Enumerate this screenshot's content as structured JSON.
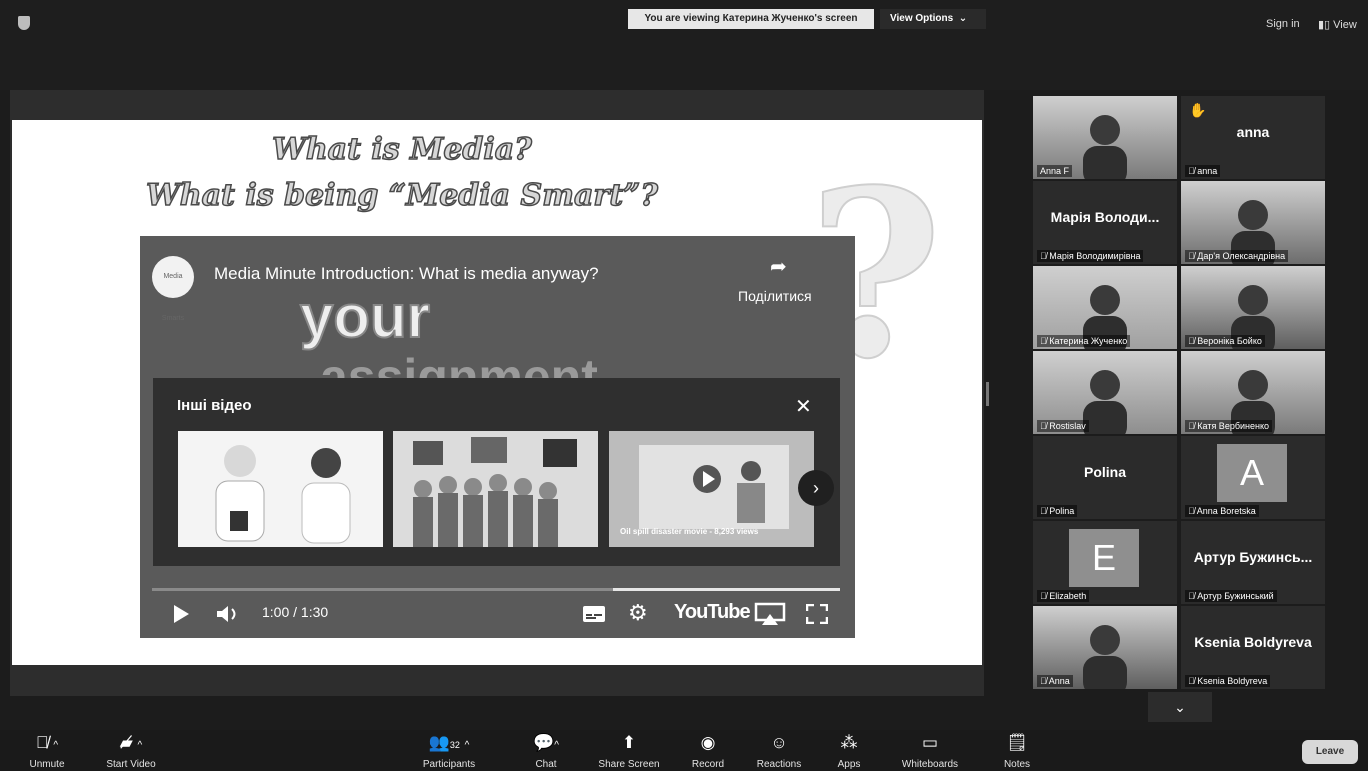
{
  "topbar": {
    "viewing_text": "You are viewing Катерина Жученко's screen",
    "view_options": "View Options",
    "view_options_caret": "⌄",
    "sign_in": "Sign in",
    "view": "View"
  },
  "slide": {
    "title_line1": "What is Media?",
    "title_line2": "What is being “Media Smart”?",
    "question_mark": "?"
  },
  "video": {
    "channel_logo_text": "Media Smarts",
    "title": "Media Minute Introduction: What is media anyway?",
    "share_label": "Поділитися",
    "overlay_word1": "your",
    "overlay_word2": "assignment",
    "more_videos_title": "Інші відео",
    "thumb3_caption": "Oil spill disaster movie - 8,293 views",
    "time": "1:00 / 1:30",
    "progress_fraction": 0.67,
    "youtube_logo": "YouTube"
  },
  "participants": [
    {
      "name": "Anna F",
      "display": "",
      "type": "video"
    },
    {
      "name": "anna",
      "display": "anna",
      "type": "name"
    },
    {
      "name": "Марія Володимирівна",
      "display": "Марія Володи...",
      "type": "name"
    },
    {
      "name": "Дар'я Олександрівна",
      "display": "",
      "type": "video"
    },
    {
      "name": "Катерина Жученко",
      "display": "",
      "type": "video"
    },
    {
      "name": "Вероніка Бойко",
      "display": "",
      "type": "video"
    },
    {
      "name": "Rostislav",
      "display": "",
      "type": "video"
    },
    {
      "name": "Катя Вербиненко",
      "display": "",
      "type": "video"
    },
    {
      "name": "Polina",
      "display": "Polina",
      "type": "name"
    },
    {
      "name": "Anna Boretska",
      "display": "A",
      "type": "letter"
    },
    {
      "name": "Elizabeth",
      "display": "E",
      "type": "letter"
    },
    {
      "name": "Артур Бужинський",
      "display": "Артур Бужинсь...",
      "type": "name"
    },
    {
      "name": "Anna",
      "display": "",
      "type": "video"
    },
    {
      "name": "Ksenia Boldyreva",
      "display": "Ksenia Boldyreva",
      "type": "name"
    }
  ],
  "toolbar": {
    "unmute": "Unmute",
    "start_video": "Start Video",
    "participants": "Participants",
    "participants_count": "32",
    "chat": "Chat",
    "share_screen": "Share Screen",
    "record": "Record",
    "reactions": "Reactions",
    "apps": "Apps",
    "whiteboards": "Whiteboards",
    "notes": "Notes",
    "leave": "Leave"
  }
}
